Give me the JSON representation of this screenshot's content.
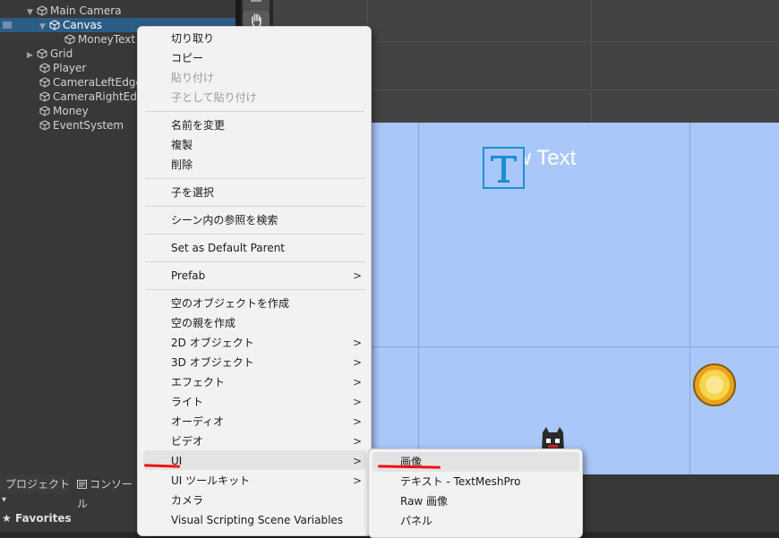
{
  "hierarchy": {
    "items": [
      {
        "label": "Main Camera",
        "fold": "▼"
      },
      {
        "label": "Canvas",
        "fold": "▼"
      },
      {
        "label": "MoneyText",
        "fold": ""
      },
      {
        "label": "Grid",
        "fold": "▶"
      },
      {
        "label": "Player",
        "fold": ""
      },
      {
        "label": "CameraLeftEdge",
        "fold": ""
      },
      {
        "label": "CameraRightEdge",
        "fold": ""
      },
      {
        "label": "Money",
        "fold": ""
      },
      {
        "label": "EventSystem",
        "fold": ""
      }
    ]
  },
  "scene": {
    "new_text": "New Text",
    "canvas_color": "#a9c7f8"
  },
  "bottom": {
    "tab_project": "プロジェクト",
    "tab_console": "コンソール",
    "favorites": "Favorites"
  },
  "context_menu": {
    "items": [
      {
        "label": "切り取り",
        "disabled": false,
        "submenu": false
      },
      {
        "label": "コピー",
        "disabled": false,
        "submenu": false
      },
      {
        "label": "貼り付け",
        "disabled": true,
        "submenu": false
      },
      {
        "label": "子として貼り付け",
        "disabled": true,
        "submenu": false
      },
      {
        "label": "名前を変更",
        "disabled": false,
        "submenu": false
      },
      {
        "label": "複製",
        "disabled": false,
        "submenu": false
      },
      {
        "label": "削除",
        "disabled": false,
        "submenu": false
      },
      {
        "label": "子を選択",
        "disabled": false,
        "submenu": false
      },
      {
        "label": "シーン内の参照を検索",
        "disabled": false,
        "submenu": false
      },
      {
        "label": "Set as Default Parent",
        "disabled": false,
        "submenu": false
      },
      {
        "label": "Prefab",
        "disabled": false,
        "submenu": true
      },
      {
        "label": "空のオブジェクトを作成",
        "disabled": false,
        "submenu": false
      },
      {
        "label": "空の親を作成",
        "disabled": false,
        "submenu": false
      },
      {
        "label": "2D オブジェクト",
        "disabled": false,
        "submenu": true
      },
      {
        "label": "3D オブジェクト",
        "disabled": false,
        "submenu": true
      },
      {
        "label": "エフェクト",
        "disabled": false,
        "submenu": true
      },
      {
        "label": "ライト",
        "disabled": false,
        "submenu": true
      },
      {
        "label": "オーディオ",
        "disabled": false,
        "submenu": true
      },
      {
        "label": "ビデオ",
        "disabled": false,
        "submenu": true
      },
      {
        "label": "UI",
        "disabled": false,
        "submenu": true
      },
      {
        "label": "UI ツールキット",
        "disabled": false,
        "submenu": true
      },
      {
        "label": "カメラ",
        "disabled": false,
        "submenu": false
      },
      {
        "label": "Visual Scripting Scene Variables",
        "disabled": false,
        "submenu": false
      }
    ],
    "arrow_glyph": ">"
  },
  "submenu": {
    "items": [
      {
        "label": "画像"
      },
      {
        "label": "テキスト - TextMeshPro"
      },
      {
        "label": "Raw 画像"
      },
      {
        "label": "パネル"
      }
    ]
  },
  "colors": {
    "selection": "#2c5d87",
    "annotation_red": "#e11"
  }
}
